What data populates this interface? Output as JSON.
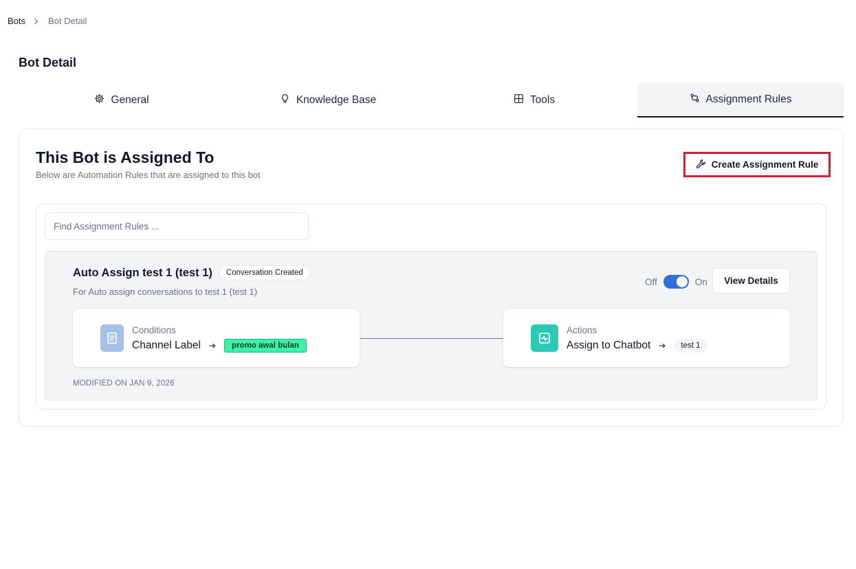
{
  "breadcrumb": {
    "root": "Bots",
    "current": "Bot Detail"
  },
  "page": {
    "title": "Bot Detail"
  },
  "tabs": [
    {
      "label": "General",
      "icon": "gear-icon",
      "active": false
    },
    {
      "label": "Knowledge Base",
      "icon": "lightbulb-icon",
      "active": false
    },
    {
      "label": "Tools",
      "icon": "grid-plus-icon",
      "active": false
    },
    {
      "label": "Assignment Rules",
      "icon": "git-compare-icon",
      "active": true
    }
  ],
  "panel": {
    "title": "This Bot is Assigned To",
    "subtitle": "Below are Automation Rules that are assigned to this bot",
    "create_button_label": "Create Assignment Rule"
  },
  "search": {
    "placeholder": "Find Assignment Rules ...",
    "value": ""
  },
  "rules": [
    {
      "name": "Auto Assign test 1 (test 1)",
      "trigger": "Conversation Created",
      "description": "For Auto assign conversations to test 1 (test 1)",
      "toggle_off_label": "Off",
      "toggle_on_label": "On",
      "enabled": true,
      "view_button_label": "View Details",
      "conditions": {
        "kind": "Conditions",
        "field": "Channel Label",
        "value": "promo awal bulan"
      },
      "actions": {
        "kind": "Actions",
        "action": "Assign to Chatbot",
        "target": "test 1"
      },
      "modified": "MODIFIED ON JAN 9, 2026"
    }
  ],
  "colors": {
    "highlight_border": "#d32031",
    "toggle_on": "#2f6fd6",
    "label_badge": "#3cf2a6",
    "conditions_icon_bg": "#a4c0e4",
    "actions_icon_bg": "#2ec9b6"
  }
}
